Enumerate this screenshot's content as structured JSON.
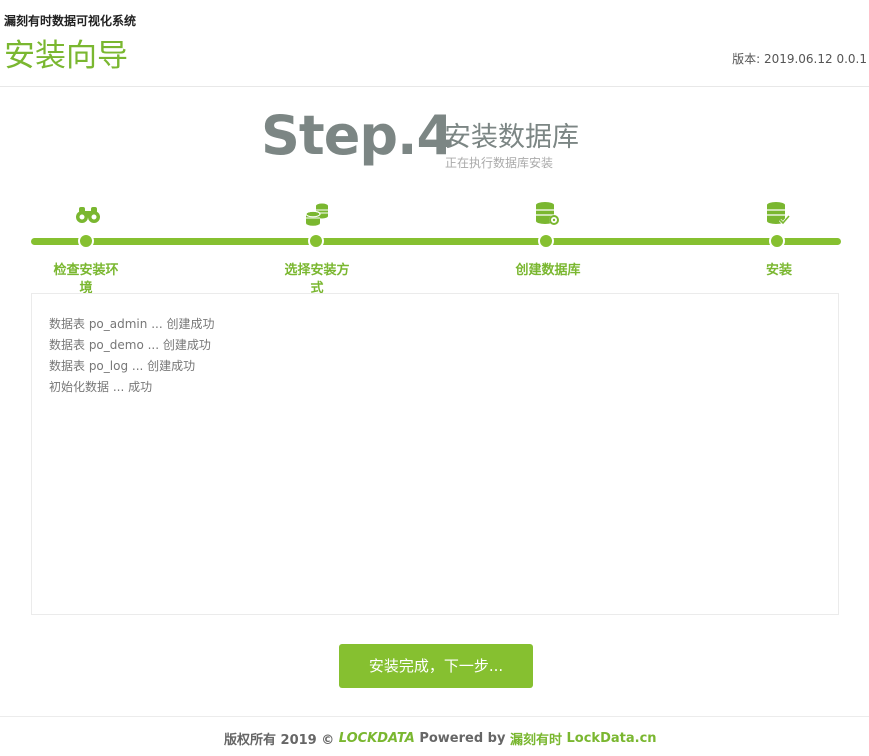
{
  "header": {
    "system_name": "漏刻有时数据可视化系统",
    "wizard_title": "安装向导",
    "version_label": "版本:",
    "version_value": "2019.06.12 0.0.1"
  },
  "step": {
    "number_text": "Step.4",
    "title": "安装数据库",
    "subtitle": "正在执行数据库安装"
  },
  "progress": {
    "steps": [
      {
        "label_line1": "检查安装环",
        "label_line2": "境",
        "icon": "binoculars-icon"
      },
      {
        "label_line1": "选择安装方",
        "label_line2": "式",
        "icon": "coins-stack-icon"
      },
      {
        "label_line1": "创建数据库",
        "label_line2": "",
        "icon": "database-settings-icon"
      },
      {
        "label_line1": "安装",
        "label_line2": "",
        "icon": "database-check-icon"
      }
    ],
    "current_step": 4,
    "total_steps": 4
  },
  "log": {
    "lines": [
      "数据表 po_admin ... 创建成功",
      "数据表 po_demo ... 创建成功",
      "数据表 po_log ... 创建成功",
      "初始化数据 ... 成功"
    ]
  },
  "actions": {
    "finish_label": "安装完成，下一步..."
  },
  "footer": {
    "copyright": "版权所有 2019 ©",
    "logo_text": "LOCKDATA",
    "powered_by": "Powered by",
    "company": "漏刻有时",
    "domain": "LockData.cn"
  },
  "colors": {
    "accent": "#7ab730",
    "progress": "#86c030",
    "step_gray": "#7c8684"
  }
}
